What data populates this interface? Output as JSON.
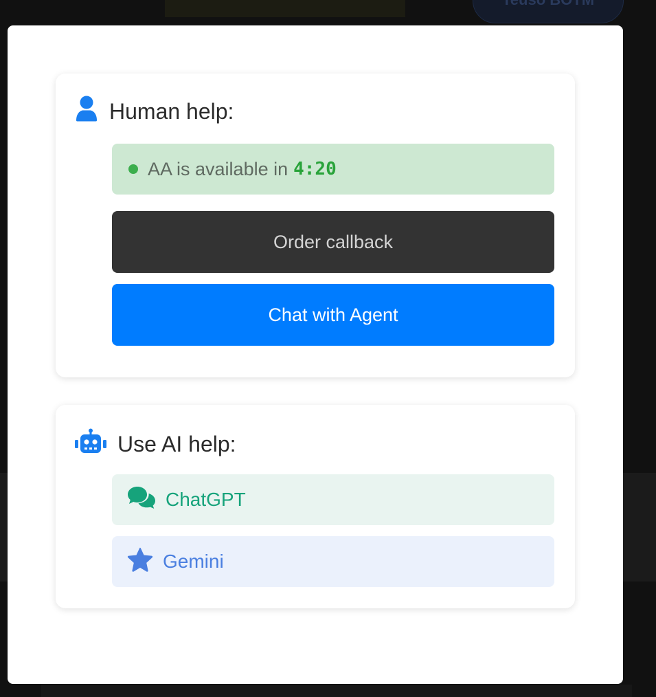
{
  "background": {
    "top_button_label": "Teuso BOTM"
  },
  "human_help": {
    "title": "Human help:",
    "icon": "user-icon",
    "availability_prefix": "AA is available in",
    "availability_time": "4:20",
    "order_callback_label": "Order callback",
    "chat_agent_label": "Chat with Agent"
  },
  "ai_help": {
    "title": "Use AI help:",
    "icon": "robot-icon",
    "options": [
      {
        "label": "ChatGPT",
        "icon": "chat-bubbles-icon"
      },
      {
        "label": "Gemini",
        "icon": "star-icon"
      }
    ]
  },
  "colors": {
    "primary": "#007cff",
    "callback_button": "#333333",
    "availability_bg": "#cde8d2",
    "status_green": "#3cae4d",
    "chatgpt_green": "#16a37b",
    "gemini_blue": "#4a7fe0"
  }
}
